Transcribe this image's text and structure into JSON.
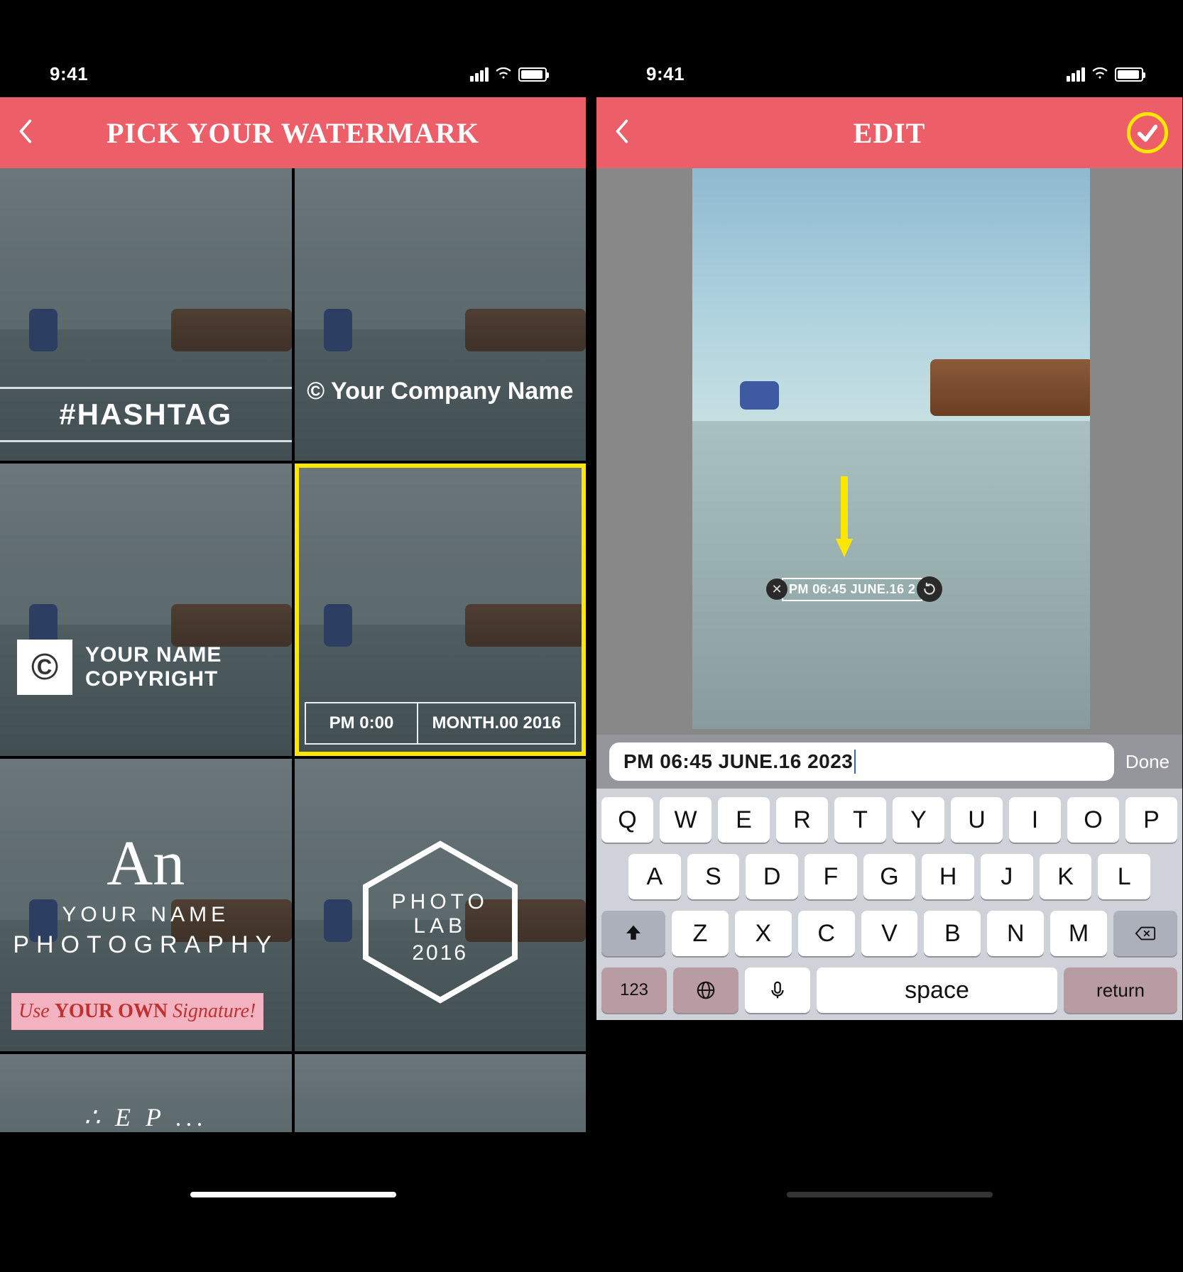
{
  "status": {
    "time": "9:41"
  },
  "left": {
    "title": "PICK YOUR WATERMARK",
    "tiles": {
      "hashtag": "#HASHTAG",
      "company": "© Your Company Name",
      "copyright_l1": "YOUR NAME",
      "copyright_l2": "COPYRIGHT",
      "ts_time": "PM 0:00",
      "ts_date": "MONTH.00 2016",
      "sig_script": "An",
      "sig_l1": "YOUR NAME",
      "sig_l2": "PHOTOGRAPHY",
      "sig_own": "Use YOUR OWN Signature!",
      "sig_own_plain_pre": "Use ",
      "sig_own_bold": "YOUR OWN",
      "sig_own_plain_post": " Signature!",
      "hex_l1": "PHOTO LAB",
      "hex_l2": "2016",
      "partial": "∴ E   P ..."
    }
  },
  "right": {
    "title": "EDIT",
    "stamp_text": "PM 06:45 JUNE.16 2",
    "input_value": "PM 06:45 JUNE.16 2023",
    "done": "Done"
  },
  "keyboard": {
    "row1": [
      "Q",
      "W",
      "E",
      "R",
      "T",
      "Y",
      "U",
      "I",
      "O",
      "P"
    ],
    "row2": [
      "A",
      "S",
      "D",
      "F",
      "G",
      "H",
      "J",
      "K",
      "L"
    ],
    "row3": [
      "Z",
      "X",
      "C",
      "V",
      "B",
      "N",
      "M"
    ],
    "numkey": "123",
    "space": "space",
    "return": "return"
  }
}
